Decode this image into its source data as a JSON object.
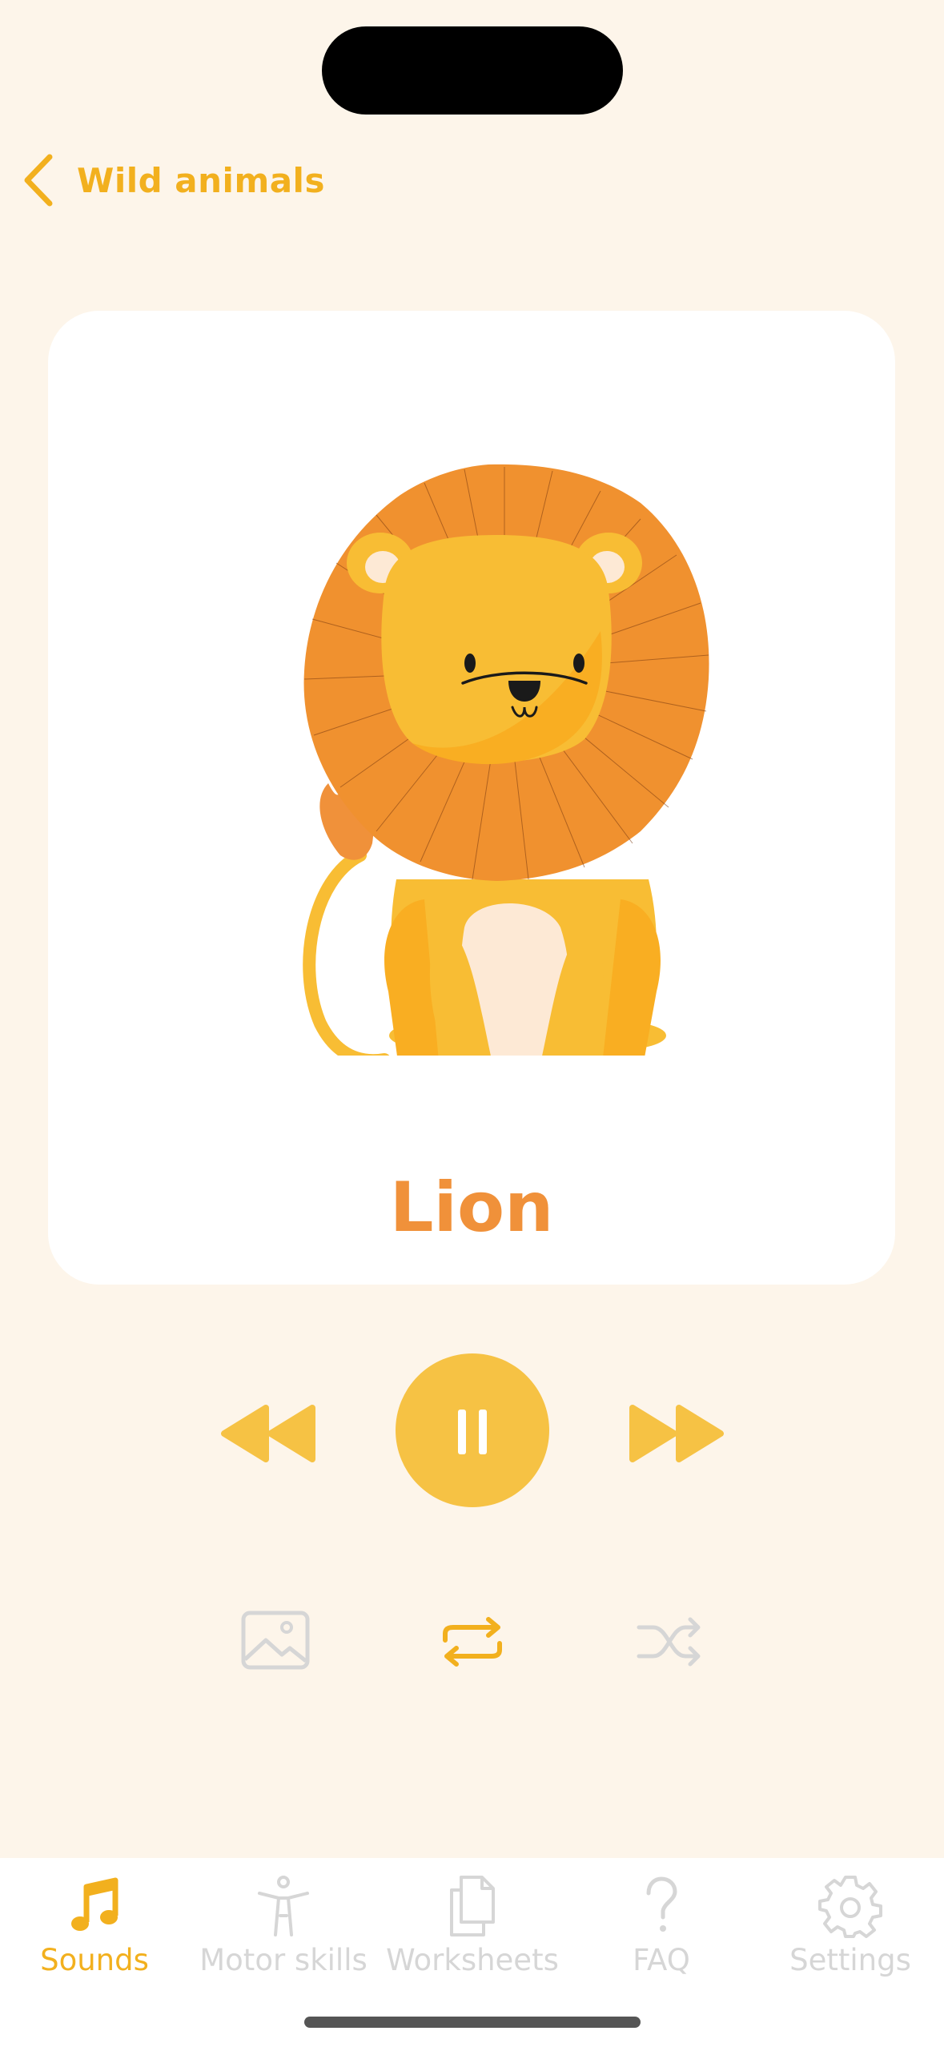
{
  "nav": {
    "back_label": "Wild animals"
  },
  "card": {
    "animal_name": "Lion"
  },
  "player": {
    "state": "playing"
  },
  "tabs": [
    {
      "label": "Sounds",
      "icon": "music-note-icon",
      "active": true
    },
    {
      "label": "Motor skills",
      "icon": "person-icon",
      "active": false
    },
    {
      "label": "Worksheets",
      "icon": "documents-icon",
      "active": false
    },
    {
      "label": "FAQ",
      "icon": "question-icon",
      "active": false
    },
    {
      "label": "Settings",
      "icon": "gear-icon",
      "active": false
    }
  ],
  "colors": {
    "accent": "#F2B01E",
    "play_button": "#F6C244",
    "inactive": "#D6D6D6",
    "background": "#FDF5EA",
    "title": "#F0913A"
  }
}
